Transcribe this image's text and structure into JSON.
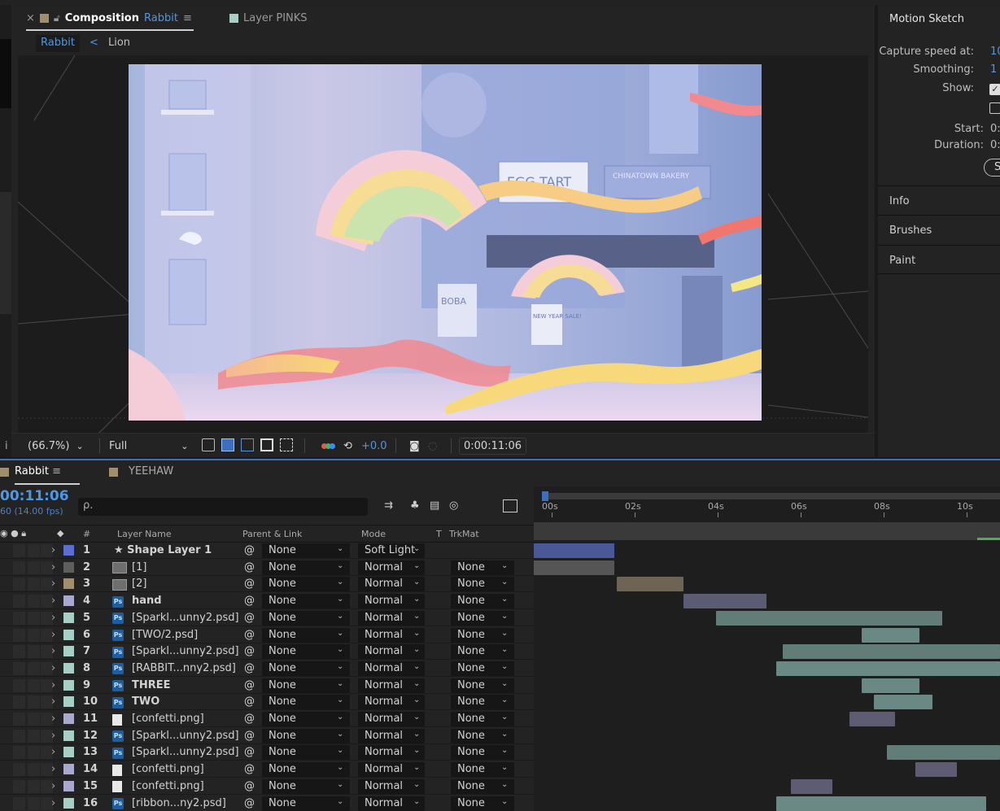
{
  "composition_tabs": {
    "close": "×",
    "prefix": "Composition",
    "name": "Rabbit",
    "menu": "≡",
    "layer_tab": "Layer PINKS"
  },
  "sub_tabs": {
    "active": "Rabbit",
    "sep": "<",
    "other": "Lion"
  },
  "viewer_bar": {
    "zoom": "(66.7%)",
    "resolution": "Full",
    "exposure": "+0.0",
    "timecode": "0:00:11:06",
    "left_glyph": "i"
  },
  "motion_sketch": {
    "title": "Motion Sketch",
    "capture_label": "Capture speed at:",
    "capture_value": "10",
    "smoothing_label": "Smoothing:",
    "smoothing_value": "1",
    "show_label": "Show:",
    "start_label": "Start:",
    "start_value": "0:",
    "duration_label": "Duration:",
    "duration_value": "0:",
    "button": "S"
  },
  "right_sections": [
    "Info",
    "Brushes",
    "Paint"
  ],
  "timeline": {
    "tab": "Rabbit",
    "tab_menu": "≡",
    "other_tab": "YEEHAW",
    "timecode": "00:11:06",
    "fps": "60 (14.00 fps)",
    "search_placeholder": "ρ.",
    "headers": {
      "num": "#",
      "layer_name": "Layer Name",
      "parent": "Parent & Link",
      "mode": "Mode",
      "t": "T",
      "trkmat": "TrkMat"
    },
    "ruler": [
      "00s",
      "02s",
      "04s",
      "06s",
      "08s",
      "10s"
    ],
    "layers": [
      {
        "n": "1",
        "name": "★ Shape Layer 1",
        "type": "shape",
        "color": "#5a6fd0",
        "parent": "None",
        "mode": "Soft Light",
        "trkmat": ""
      },
      {
        "n": "2",
        "name": "[1]",
        "type": "comp",
        "color": "#5e5e5e",
        "parent": "None",
        "mode": "Normal",
        "trkmat": "None"
      },
      {
        "n": "3",
        "name": "[2]",
        "type": "comp",
        "color": "#a38e6b",
        "parent": "None",
        "mode": "Normal",
        "trkmat": "None"
      },
      {
        "n": "4",
        "name": "hand",
        "type": "ps",
        "color": "#a9a8cf",
        "parent": "None",
        "mode": "Normal",
        "trkmat": "None"
      },
      {
        "n": "5",
        "name": "[Sparkl...unny2.psd]",
        "type": "ps",
        "color": "#a8cfc6",
        "parent": "None",
        "mode": "Normal",
        "trkmat": "None"
      },
      {
        "n": "6",
        "name": "[TWO/2.psd]",
        "type": "ps",
        "color": "#a8cfc6",
        "parent": "None",
        "mode": "Normal",
        "trkmat": "None"
      },
      {
        "n": "7",
        "name": "[Sparkl...unny2.psd]",
        "type": "ps",
        "color": "#a8cfc6",
        "parent": "None",
        "mode": "Normal",
        "trkmat": "None"
      },
      {
        "n": "8",
        "name": "[RABBIT...nny2.psd]",
        "type": "ps",
        "color": "#a8cfc6",
        "parent": "None",
        "mode": "Normal",
        "trkmat": "None"
      },
      {
        "n": "9",
        "name": "THREE",
        "type": "ps",
        "color": "#a8cfc6",
        "parent": "None",
        "mode": "Normal",
        "trkmat": "None"
      },
      {
        "n": "10",
        "name": "TWO",
        "type": "ps",
        "color": "#a8cfc6",
        "parent": "None",
        "mode": "Normal",
        "trkmat": "None"
      },
      {
        "n": "11",
        "name": "[confetti.png]",
        "type": "png",
        "color": "#a9a8cf",
        "parent": "None",
        "mode": "Normal",
        "trkmat": "None"
      },
      {
        "n": "12",
        "name": "[Sparkl...unny2.psd]",
        "type": "ps",
        "color": "#a8cfc6",
        "parent": "None",
        "mode": "Normal",
        "trkmat": "None"
      },
      {
        "n": "13",
        "name": "[Sparkl...unny2.psd]",
        "type": "ps",
        "color": "#a8cfc6",
        "parent": "None",
        "mode": "Normal",
        "trkmat": "None"
      },
      {
        "n": "14",
        "name": "[confetti.png]",
        "type": "png",
        "color": "#a9a8cf",
        "parent": "None",
        "mode": "Normal",
        "trkmat": "None"
      },
      {
        "n": "15",
        "name": "[confetti.png]",
        "type": "png",
        "color": "#a9a8cf",
        "parent": "None",
        "mode": "Normal",
        "trkmat": "None"
      },
      {
        "n": "16",
        "name": "[ribbon...ny2.psd]",
        "type": "ps",
        "color": "#a8cfc6",
        "parent": "None",
        "mode": "Normal",
        "trkmat": "None"
      }
    ]
  },
  "artwork_text": {
    "egg_tart": "EGG TART",
    "chinatown": "CHINATOWN BAKERY",
    "boba": "BOBA",
    "sale": "NEW YEAR SALE!"
  }
}
